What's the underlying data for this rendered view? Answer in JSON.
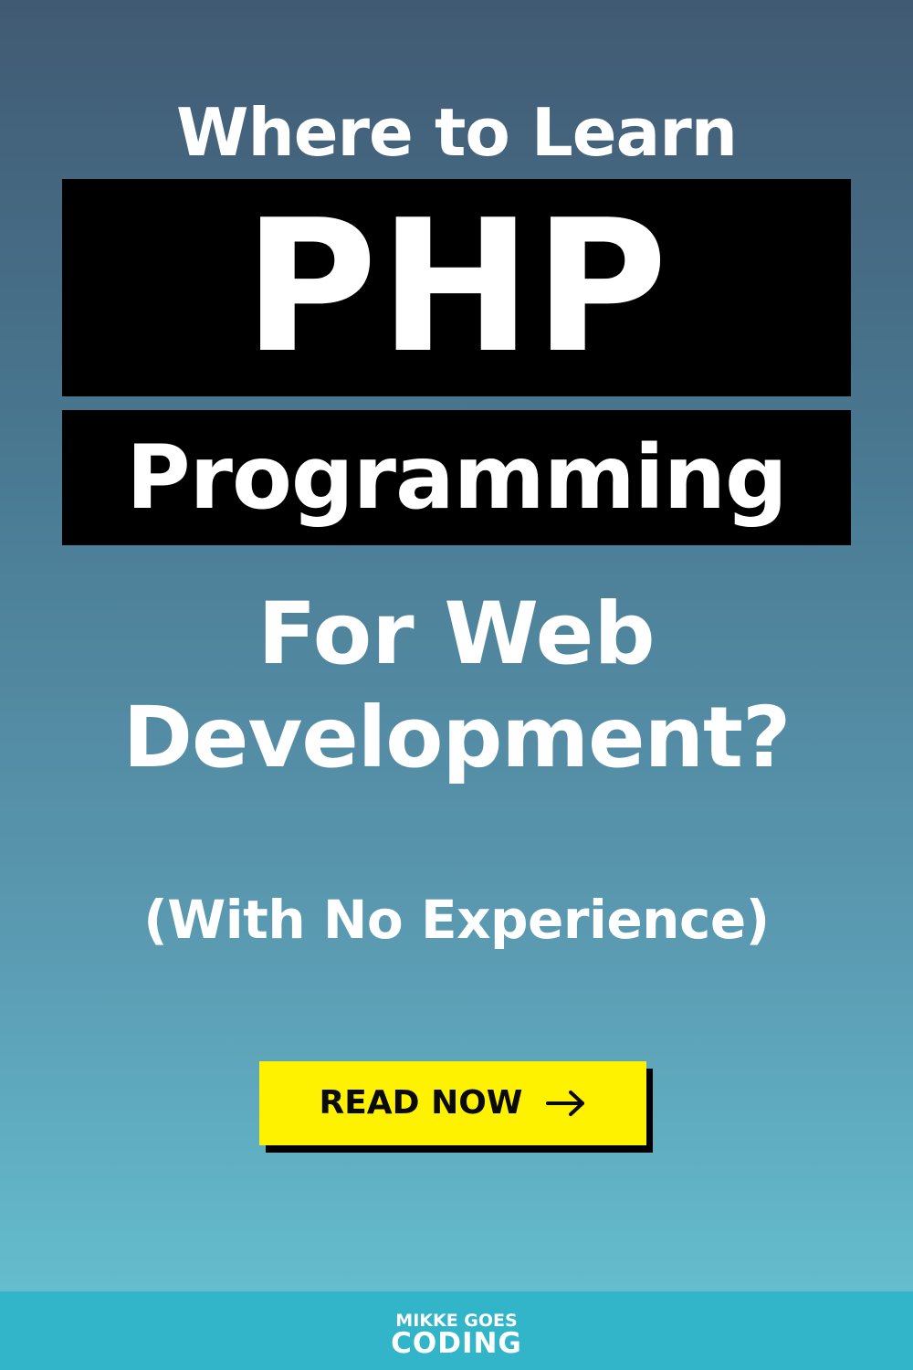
{
  "headline": {
    "line1": "Where to Learn",
    "highlight1": "PHP",
    "highlight2": "Programming",
    "line4": "For Web",
    "line5": "Development?",
    "subtitle": "(With No Experience)"
  },
  "cta": {
    "label": "READ NOW",
    "icon": "arrow-right-icon"
  },
  "logo": {
    "line1": "MIKKE GOES",
    "line2": "CODING"
  },
  "colors": {
    "gradient_top": "#415a73",
    "gradient_bottom": "#64bccc",
    "highlight_box": "#000000",
    "button": "#fff200",
    "footer_bar": "#32b5c9",
    "text": "#ffffff"
  }
}
